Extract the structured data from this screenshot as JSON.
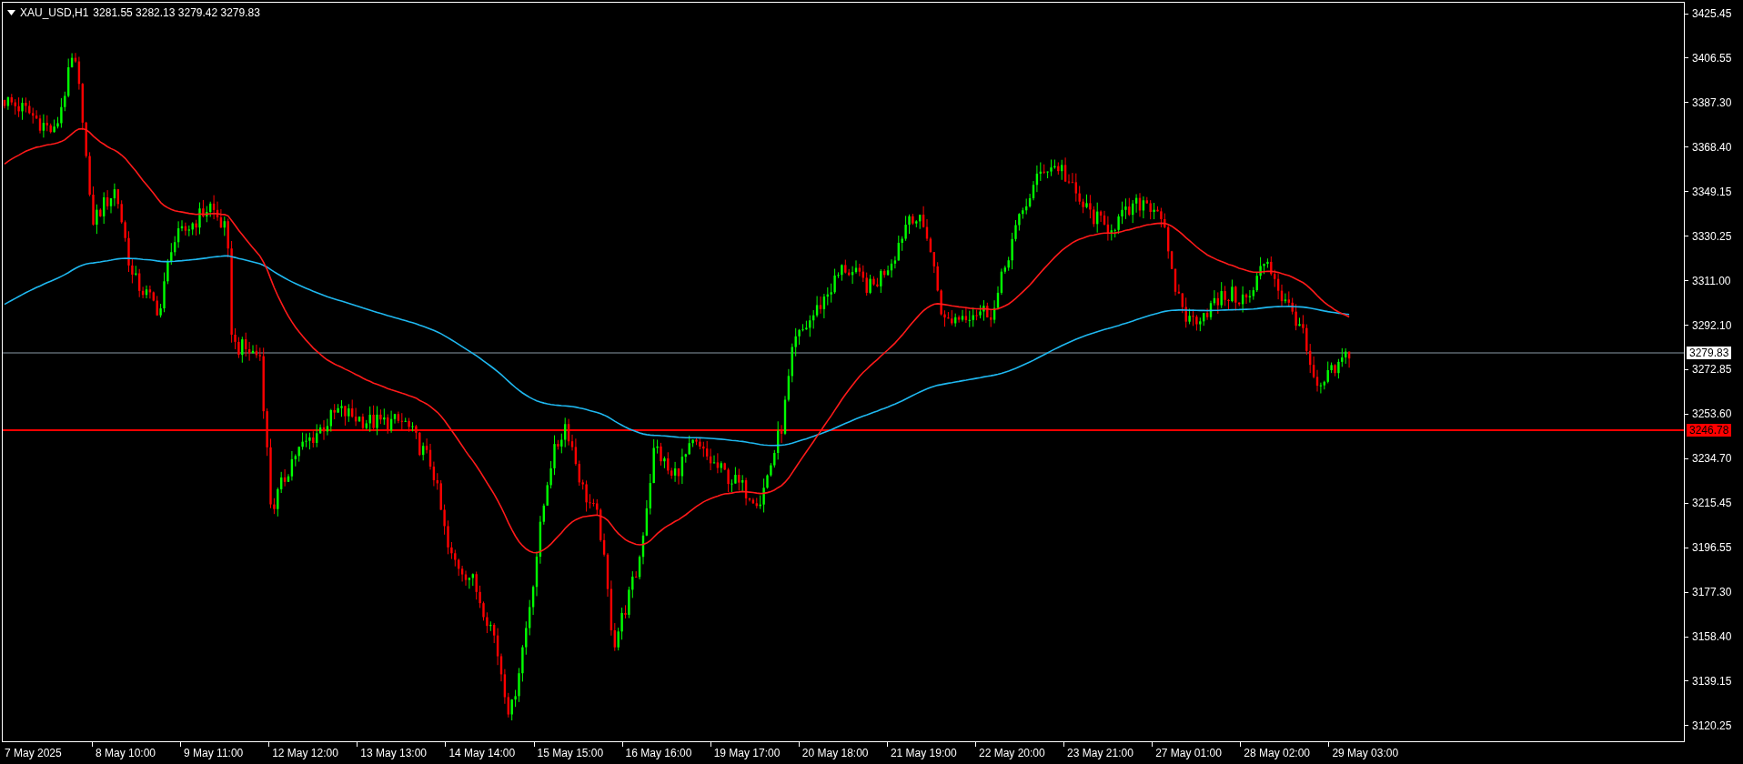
{
  "header": {
    "symbol": "XAU_USD,H1",
    "ohlc": "3281.55 3282.13 3279.42 3279.83"
  },
  "price_axis": {
    "ticks": [
      "3425.45",
      "3406.55",
      "3387.30",
      "3368.40",
      "3349.15",
      "3330.25",
      "3311.00",
      "3292.10",
      "3272.85",
      "3253.60",
      "3234.70",
      "3215.45",
      "3196.55",
      "3177.30",
      "3158.40",
      "3139.15",
      "3120.25"
    ]
  },
  "price_labels": [
    {
      "kind": "bid",
      "text": "3279.83"
    },
    {
      "kind": "level",
      "text": "3246.78"
    }
  ],
  "time_axis": {
    "labels": [
      "7 May 2025",
      "8 May 10:00",
      "9 May 11:00",
      "12 May 12:00",
      "13 May 13:00",
      "14 May 14:00",
      "15 May 15:00",
      "16 May 16:00",
      "19 May 17:00",
      "20 May 18:00",
      "21 May 19:00",
      "22 May 20:00",
      "23 May 21:00",
      "27 May 01:00",
      "28 May 02:00",
      "29 May 03:00"
    ]
  }
}
